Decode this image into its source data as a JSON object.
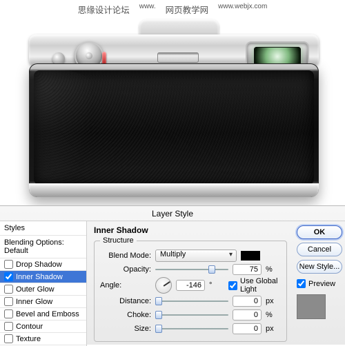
{
  "watermark": {
    "left": "思缘设计论坛",
    "left_small": "www.",
    "right": "网页教学网",
    "right_small": "www.webjx.com"
  },
  "dialog": {
    "title": "Layer Style",
    "right": {
      "ok": "OK",
      "cancel": "Cancel",
      "new_style": "New Style...",
      "preview": "Preview"
    },
    "list": {
      "styles": "Styles",
      "blending": "Blending Options: Default",
      "items": [
        {
          "label": "Drop Shadow",
          "checked": false,
          "selected": false
        },
        {
          "label": "Inner Shadow",
          "checked": true,
          "selected": true
        },
        {
          "label": "Outer Glow",
          "checked": false,
          "selected": false
        },
        {
          "label": "Inner Glow",
          "checked": false,
          "selected": false
        },
        {
          "label": "Bevel and Emboss",
          "checked": false,
          "selected": false
        },
        {
          "label": "Contour",
          "checked": false,
          "selected": false
        },
        {
          "label": "Texture",
          "checked": false,
          "selected": false
        }
      ]
    },
    "section_title": "Inner Shadow",
    "structure_legend": "Structure",
    "labels": {
      "blend_mode": "Blend Mode:",
      "opacity": "Opacity:",
      "angle": "Angle:",
      "use_global": "Use Global Light",
      "distance": "Distance:",
      "choke": "Choke:",
      "size": "Size:"
    },
    "values": {
      "blend_mode": "Multiply",
      "opacity": "75",
      "angle": "-146",
      "distance": "0",
      "choke": "0",
      "size": "0"
    },
    "units": {
      "pct": "%",
      "deg": "°",
      "px": "px"
    }
  }
}
